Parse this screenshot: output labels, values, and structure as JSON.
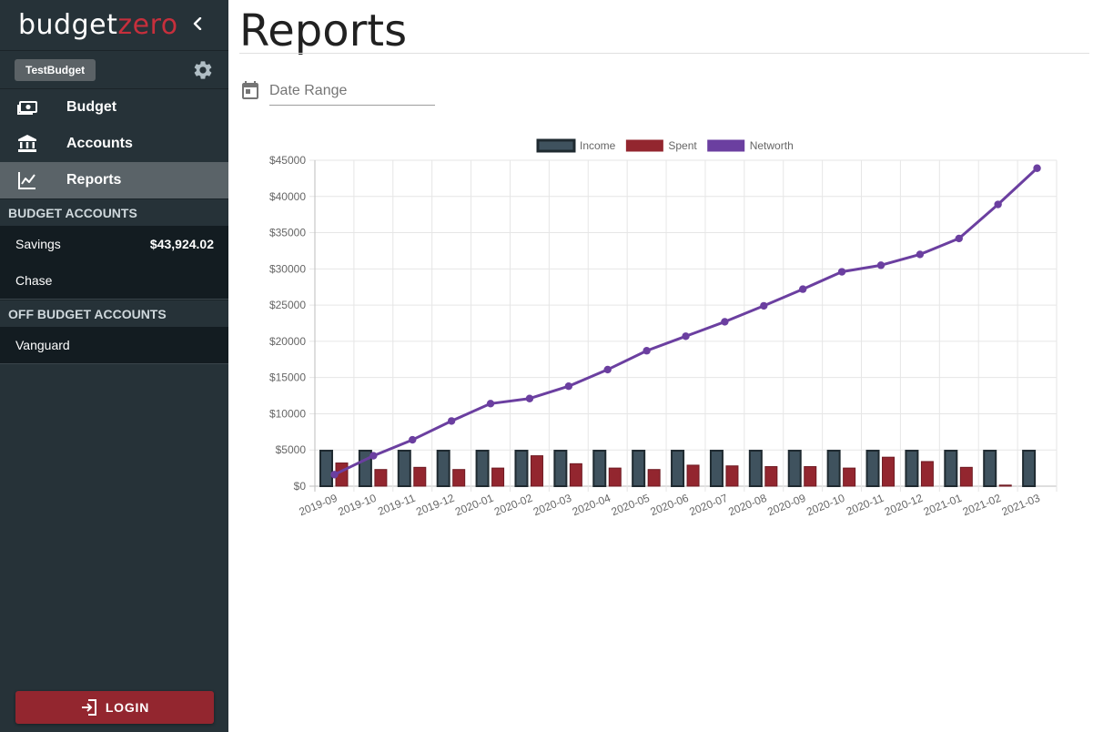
{
  "brand": {
    "part1": "budget",
    "part2": "zero"
  },
  "budget": {
    "name": "TestBudget"
  },
  "nav": [
    {
      "label": "Budget",
      "icon": "money-icon"
    },
    {
      "label": "Accounts",
      "icon": "bank-icon"
    },
    {
      "label": "Reports",
      "icon": "chart-line-icon"
    }
  ],
  "sections": {
    "budget_accounts": "BUDGET ACCOUNTS",
    "off_budget_accounts": "OFF BUDGET ACCOUNTS"
  },
  "budget_accounts": [
    {
      "name": "Savings",
      "balance": "$43,924.02"
    },
    {
      "name": "Chase",
      "balance": ""
    }
  ],
  "off_budget_accounts": [
    {
      "name": "Vanguard",
      "balance": ""
    }
  ],
  "login": {
    "label": "LOGIN"
  },
  "page": {
    "title": "Reports"
  },
  "date_range": {
    "placeholder": "Date Range"
  },
  "colors": {
    "income": "#3f525e",
    "income_border": "#1f2a30",
    "spent": "#93262f",
    "networth": "#6b3fa0",
    "brand_accent": "#c62f3c"
  },
  "chart_data": {
    "type": "bar",
    "categories": [
      "2019-09",
      "2019-10",
      "2019-11",
      "2019-12",
      "2020-01",
      "2020-02",
      "2020-03",
      "2020-04",
      "2020-05",
      "2020-06",
      "2020-07",
      "2020-08",
      "2020-09",
      "2020-10",
      "2020-11",
      "2020-12",
      "2021-01",
      "2021-02",
      "2021-03"
    ],
    "series": [
      {
        "name": "Income",
        "type": "bar",
        "values": [
          4900,
          4900,
          4900,
          4900,
          4900,
          4900,
          4900,
          4900,
          4900,
          4900,
          4900,
          4900,
          4900,
          4900,
          4900,
          4900,
          4900,
          4900,
          4900
        ]
      },
      {
        "name": "Spent",
        "type": "bar",
        "values": [
          3200,
          2300,
          2600,
          2300,
          2500,
          4200,
          3100,
          2500,
          2300,
          2900,
          2800,
          2700,
          2700,
          2500,
          4000,
          3400,
          2600,
          150,
          0
        ]
      },
      {
        "name": "Networth",
        "type": "line",
        "values": [
          1600,
          4200,
          6400,
          9000,
          11400,
          12100,
          13800,
          16100,
          18700,
          20700,
          22700,
          24900,
          27200,
          29600,
          30500,
          32000,
          34200,
          38900,
          43900
        ]
      }
    ],
    "yticks": [
      "$0",
      "$5000",
      "$10000",
      "$15000",
      "$20000",
      "$25000",
      "$30000",
      "$35000",
      "$40000",
      "$45000"
    ],
    "ylim": [
      0,
      45000
    ],
    "legend": "top-center",
    "grid": true
  }
}
